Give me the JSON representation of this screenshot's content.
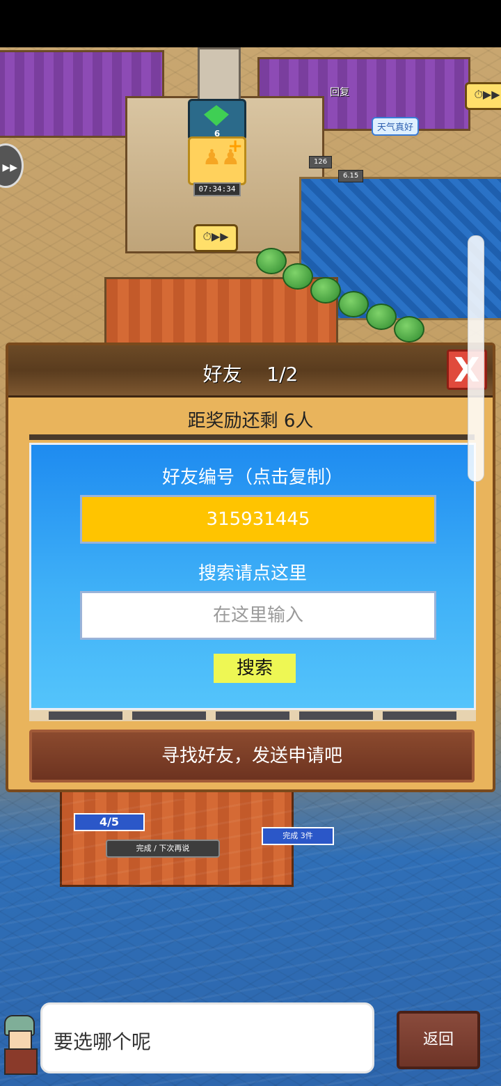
{
  "map": {
    "recover_label": "回复",
    "weather_label": "天气真好",
    "crystal_count": "6",
    "timer": "07:34:34",
    "tag_one": "126",
    "tag_two": "6.15",
    "speed_label": "⏱▶▶",
    "counter": "4/5",
    "status_left": "完成 / 下次再说",
    "status_right": "完成 3件"
  },
  "dialog": {
    "title": "好友    1/2",
    "close_label": "X",
    "reward_text": "距奖励还剩 6人",
    "friend_code_label": "好友编号（点击复制）",
    "friend_code": "315931445",
    "search_label": "搜索请点这里",
    "search_placeholder": "在这里输入",
    "search_button": "搜索",
    "find_friends_button": "寻找好友，发送申请吧"
  },
  "chat": {
    "message": "要选哪个呢",
    "back_button": "返回"
  },
  "colors": {
    "dialog_frame": "#e9b45c",
    "panel_blue": "#1e8bf0",
    "code_yellow": "#ffc400",
    "search_btn": "#eef754"
  }
}
